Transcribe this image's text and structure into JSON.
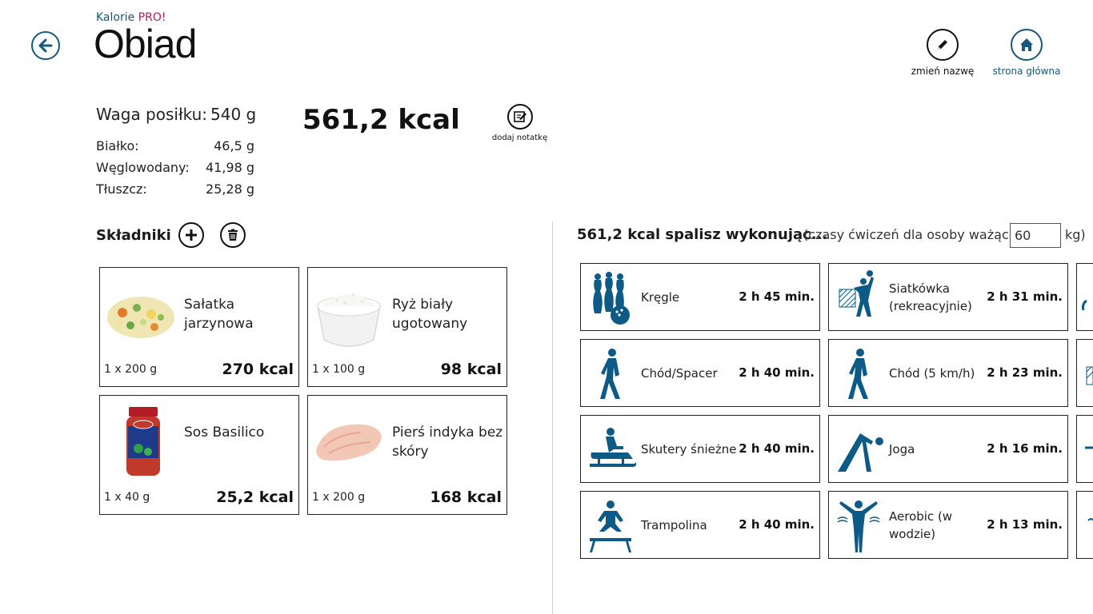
{
  "app": {
    "name_prefix": "Kalorie ",
    "name_suffix": "PRO!",
    "page_title": "Obiad"
  },
  "header_actions": {
    "rename_label": "zmień nazwę",
    "home_label": "strona główna"
  },
  "summary": {
    "weight_label": "Waga posiłku:",
    "weight_value": "540 g",
    "total_kcal": "561,2 kcal",
    "note_label": "dodaj notatkę",
    "macros": [
      {
        "label": "Białko:",
        "value": "46,5 g"
      },
      {
        "label": "Węglowodany:",
        "value": "41,98 g"
      },
      {
        "label": "Tłuszcz:",
        "value": "25,28 g"
      }
    ]
  },
  "ingredients": {
    "title": "Składniki",
    "items": [
      {
        "name": "Sałatka jarzynowa",
        "qty": "1 x 200 g",
        "kcal": "270 kcal",
        "image": "vegetable-salad"
      },
      {
        "name": "Ryż biały ugotowany",
        "qty": "1 x 100 g",
        "kcal": "98 kcal",
        "image": "white-rice-bowl"
      },
      {
        "name": "Sos Basilico",
        "qty": "1 x 40 g",
        "kcal": "25,2 kcal",
        "image": "tomato-sauce-jar"
      },
      {
        "name": "Pierś indyka bez skóry",
        "qty": "1 x 200 g",
        "kcal": "168 kcal",
        "image": "turkey-breast"
      }
    ]
  },
  "exercises": {
    "title": "561,2 kcal spalisz wykonując...",
    "subtitle": "(czasy ćwiczeń dla osoby ważącej",
    "weight_input_value": "60",
    "unit_suffix": "kg)",
    "columns": [
      [
        {
          "name": "Kręgle",
          "time": "2 h 45 min.",
          "icon": "bowling-icon"
        },
        {
          "name": "Chód/Spacer",
          "time": "2 h 40 min.",
          "icon": "walking-icon"
        },
        {
          "name": "Skutery śnieżne",
          "time": "2 h 40 min.",
          "icon": "snowmobile-icon"
        },
        {
          "name": "Trampolina",
          "time": "2 h 40 min.",
          "icon": "trampoline-icon"
        }
      ],
      [
        {
          "name": "Siatkówka (rekreacyjnie)",
          "time": "2 h 31 min.",
          "icon": "volleyball-icon"
        },
        {
          "name": "Chód (5 km/h)",
          "time": "2 h 23 min.",
          "icon": "walking-icon"
        },
        {
          "name": "Joga",
          "time": "2 h 16 min.",
          "icon": "yoga-icon"
        },
        {
          "name": "Aerobic (w wodzie)",
          "time": "2 h 13 min.",
          "icon": "water-aerobics-icon"
        }
      ]
    ]
  },
  "colors": {
    "accent": "#17587a",
    "brand_pink": "#a0206a",
    "icon_blue": "#0e5a86"
  }
}
